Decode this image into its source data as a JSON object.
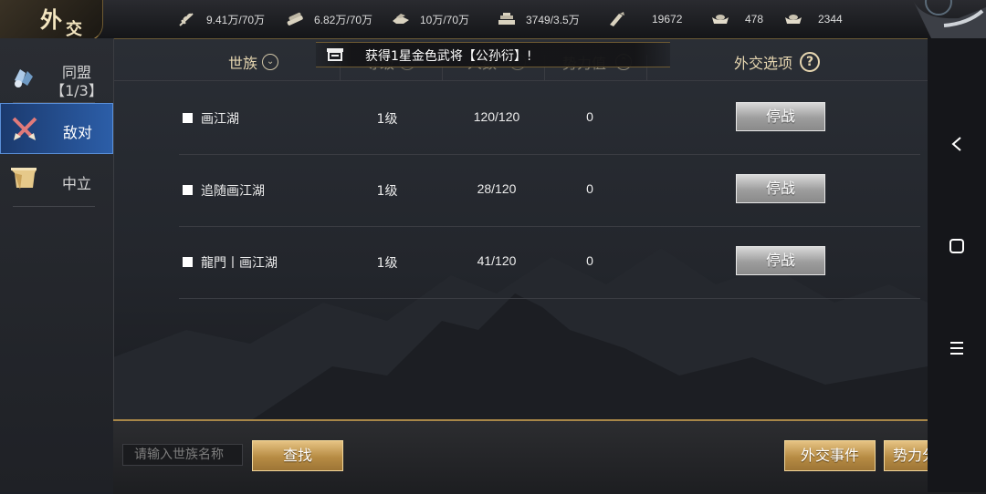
{
  "title": {
    "char1": "外",
    "char2": "交"
  },
  "resources": [
    {
      "icon": "grain-icon",
      "value": "9.41万/70万"
    },
    {
      "icon": "wood-icon",
      "value": "6.82万/70万"
    },
    {
      "icon": "iron-icon",
      "value": "10万/70万"
    },
    {
      "icon": "stone-icon",
      "value": "3749/3.5万"
    },
    {
      "icon": "decree-icon",
      "value": "19672"
    },
    {
      "icon": "gold-ingot-icon",
      "value": "478"
    },
    {
      "icon": "silver-ingot-icon",
      "value": "2344"
    }
  ],
  "sidebar": {
    "items": [
      {
        "label": "同盟",
        "sub": "【1/3】"
      },
      {
        "label": "敌对"
      },
      {
        "label": "中立"
      }
    ]
  },
  "header": {
    "clan": "世族",
    "level": "等级",
    "members": "人数",
    "power": "势力值",
    "options": "外交选项"
  },
  "notice": "获得1星金色武将【公孙衍】!",
  "rows": [
    {
      "name": "画江湖",
      "level": "1级",
      "members": "120/120",
      "power": "0",
      "action": "停战"
    },
    {
      "name": "追随画江湖",
      "level": "1级",
      "members": "28/120",
      "power": "0",
      "action": "停战"
    },
    {
      "name": "龍門丨画江湖",
      "level": "1级",
      "members": "41/120",
      "power": "0",
      "action": "停战"
    }
  ],
  "bottom": {
    "search_placeholder": "请输入世族名称",
    "search_button": "查找",
    "events_button": "外交事件",
    "map_button": "势力分布图"
  },
  "colors": {
    "accent_gold": "#c9a25a",
    "active_tab": "#2c5ea8"
  }
}
